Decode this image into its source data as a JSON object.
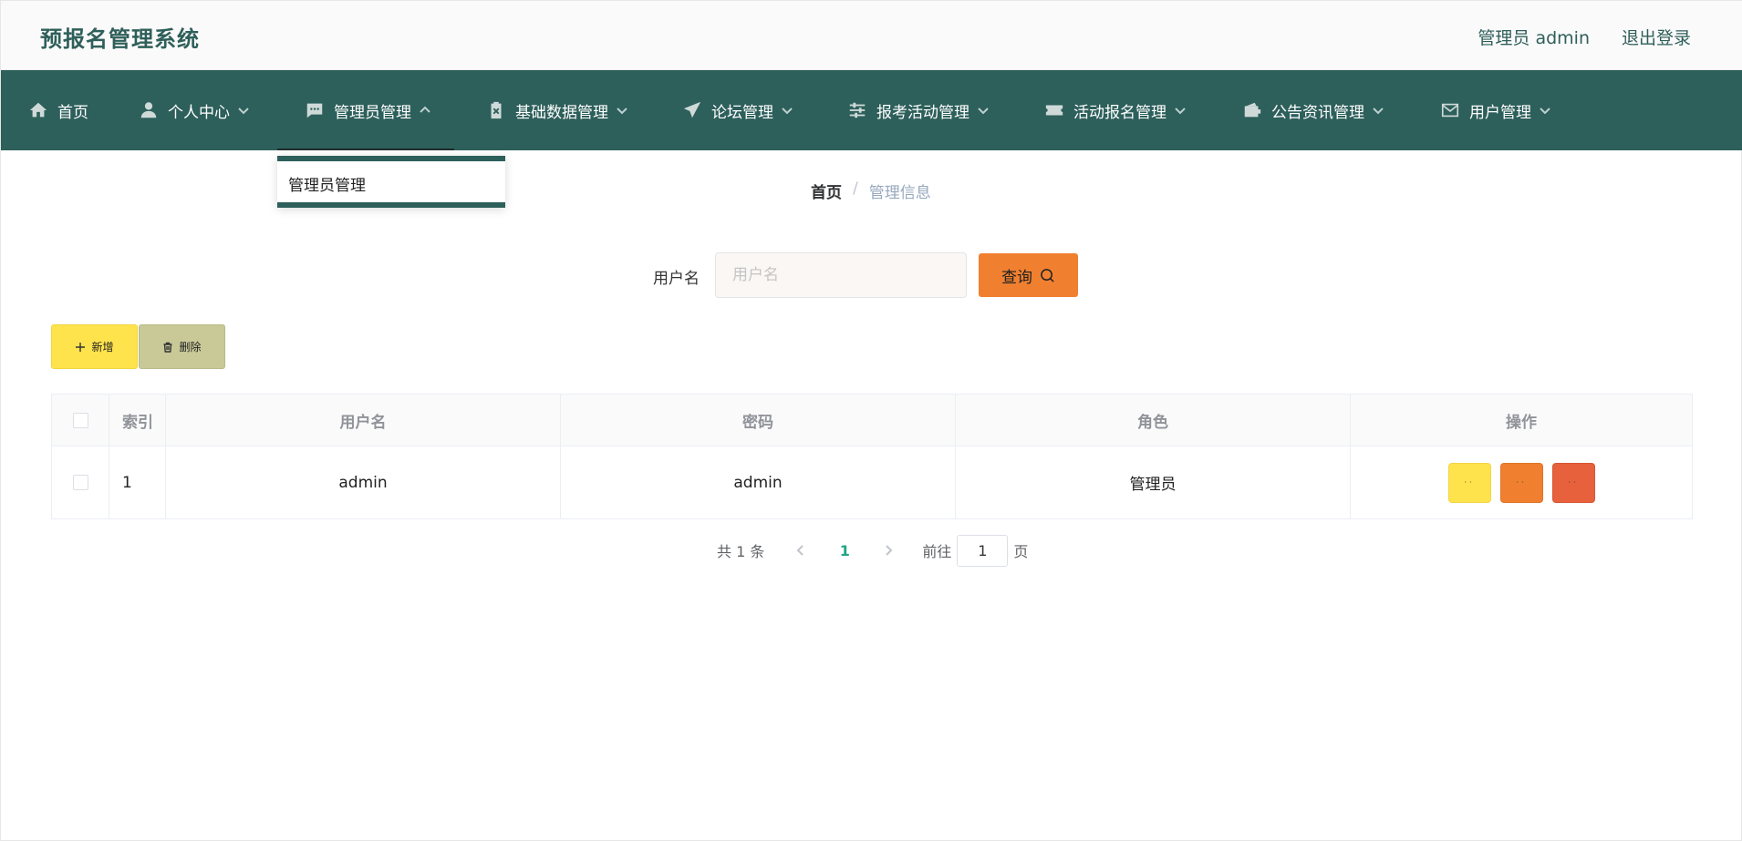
{
  "header": {
    "app_title": "预报名管理系统",
    "user_label": "管理员 admin",
    "logout": "退出登录"
  },
  "nav": {
    "items": [
      {
        "label": "首页",
        "icon": "home-icon"
      },
      {
        "label": "个人中心",
        "icon": "user-icon"
      },
      {
        "label": "管理员管理",
        "icon": "chat-icon",
        "active": true
      },
      {
        "label": "基础数据管理",
        "icon": "clipboard-icon"
      },
      {
        "label": "论坛管理",
        "icon": "send-icon"
      },
      {
        "label": "报考活动管理",
        "icon": "sliders-icon"
      },
      {
        "label": "活动报名管理",
        "icon": "ticket-icon"
      },
      {
        "label": "公告资讯管理",
        "icon": "wallet-icon"
      },
      {
        "label": "用户管理",
        "icon": "mail-icon"
      }
    ]
  },
  "dropdown": {
    "items": [
      "管理员管理"
    ]
  },
  "breadcrumb": {
    "home": "首页",
    "separator": "/",
    "current": "管理信息"
  },
  "search": {
    "label": "用户名",
    "placeholder": "用户名",
    "value": "",
    "button_label": "查询"
  },
  "actions": {
    "add_label": "新增",
    "delete_label": "删除"
  },
  "table": {
    "columns": [
      "索引",
      "用户名",
      "密码",
      "角色",
      "操作"
    ],
    "rows": [
      {
        "index": "1",
        "username": "admin",
        "password": "admin",
        "role": "管理员"
      }
    ],
    "row_actions": [
      "··",
      "··",
      "··"
    ]
  },
  "pagination": {
    "total_text": "共 1 条",
    "current_page": "1",
    "goto_label": "前往",
    "goto_value": "1",
    "page_unit": "页"
  },
  "colors": {
    "brand": "#2d5f5b",
    "accent_orange": "#f08030",
    "yellow": "#ffe34d",
    "olive": "#c8c997",
    "red": "#e8613d",
    "page_active": "#20a58a"
  }
}
